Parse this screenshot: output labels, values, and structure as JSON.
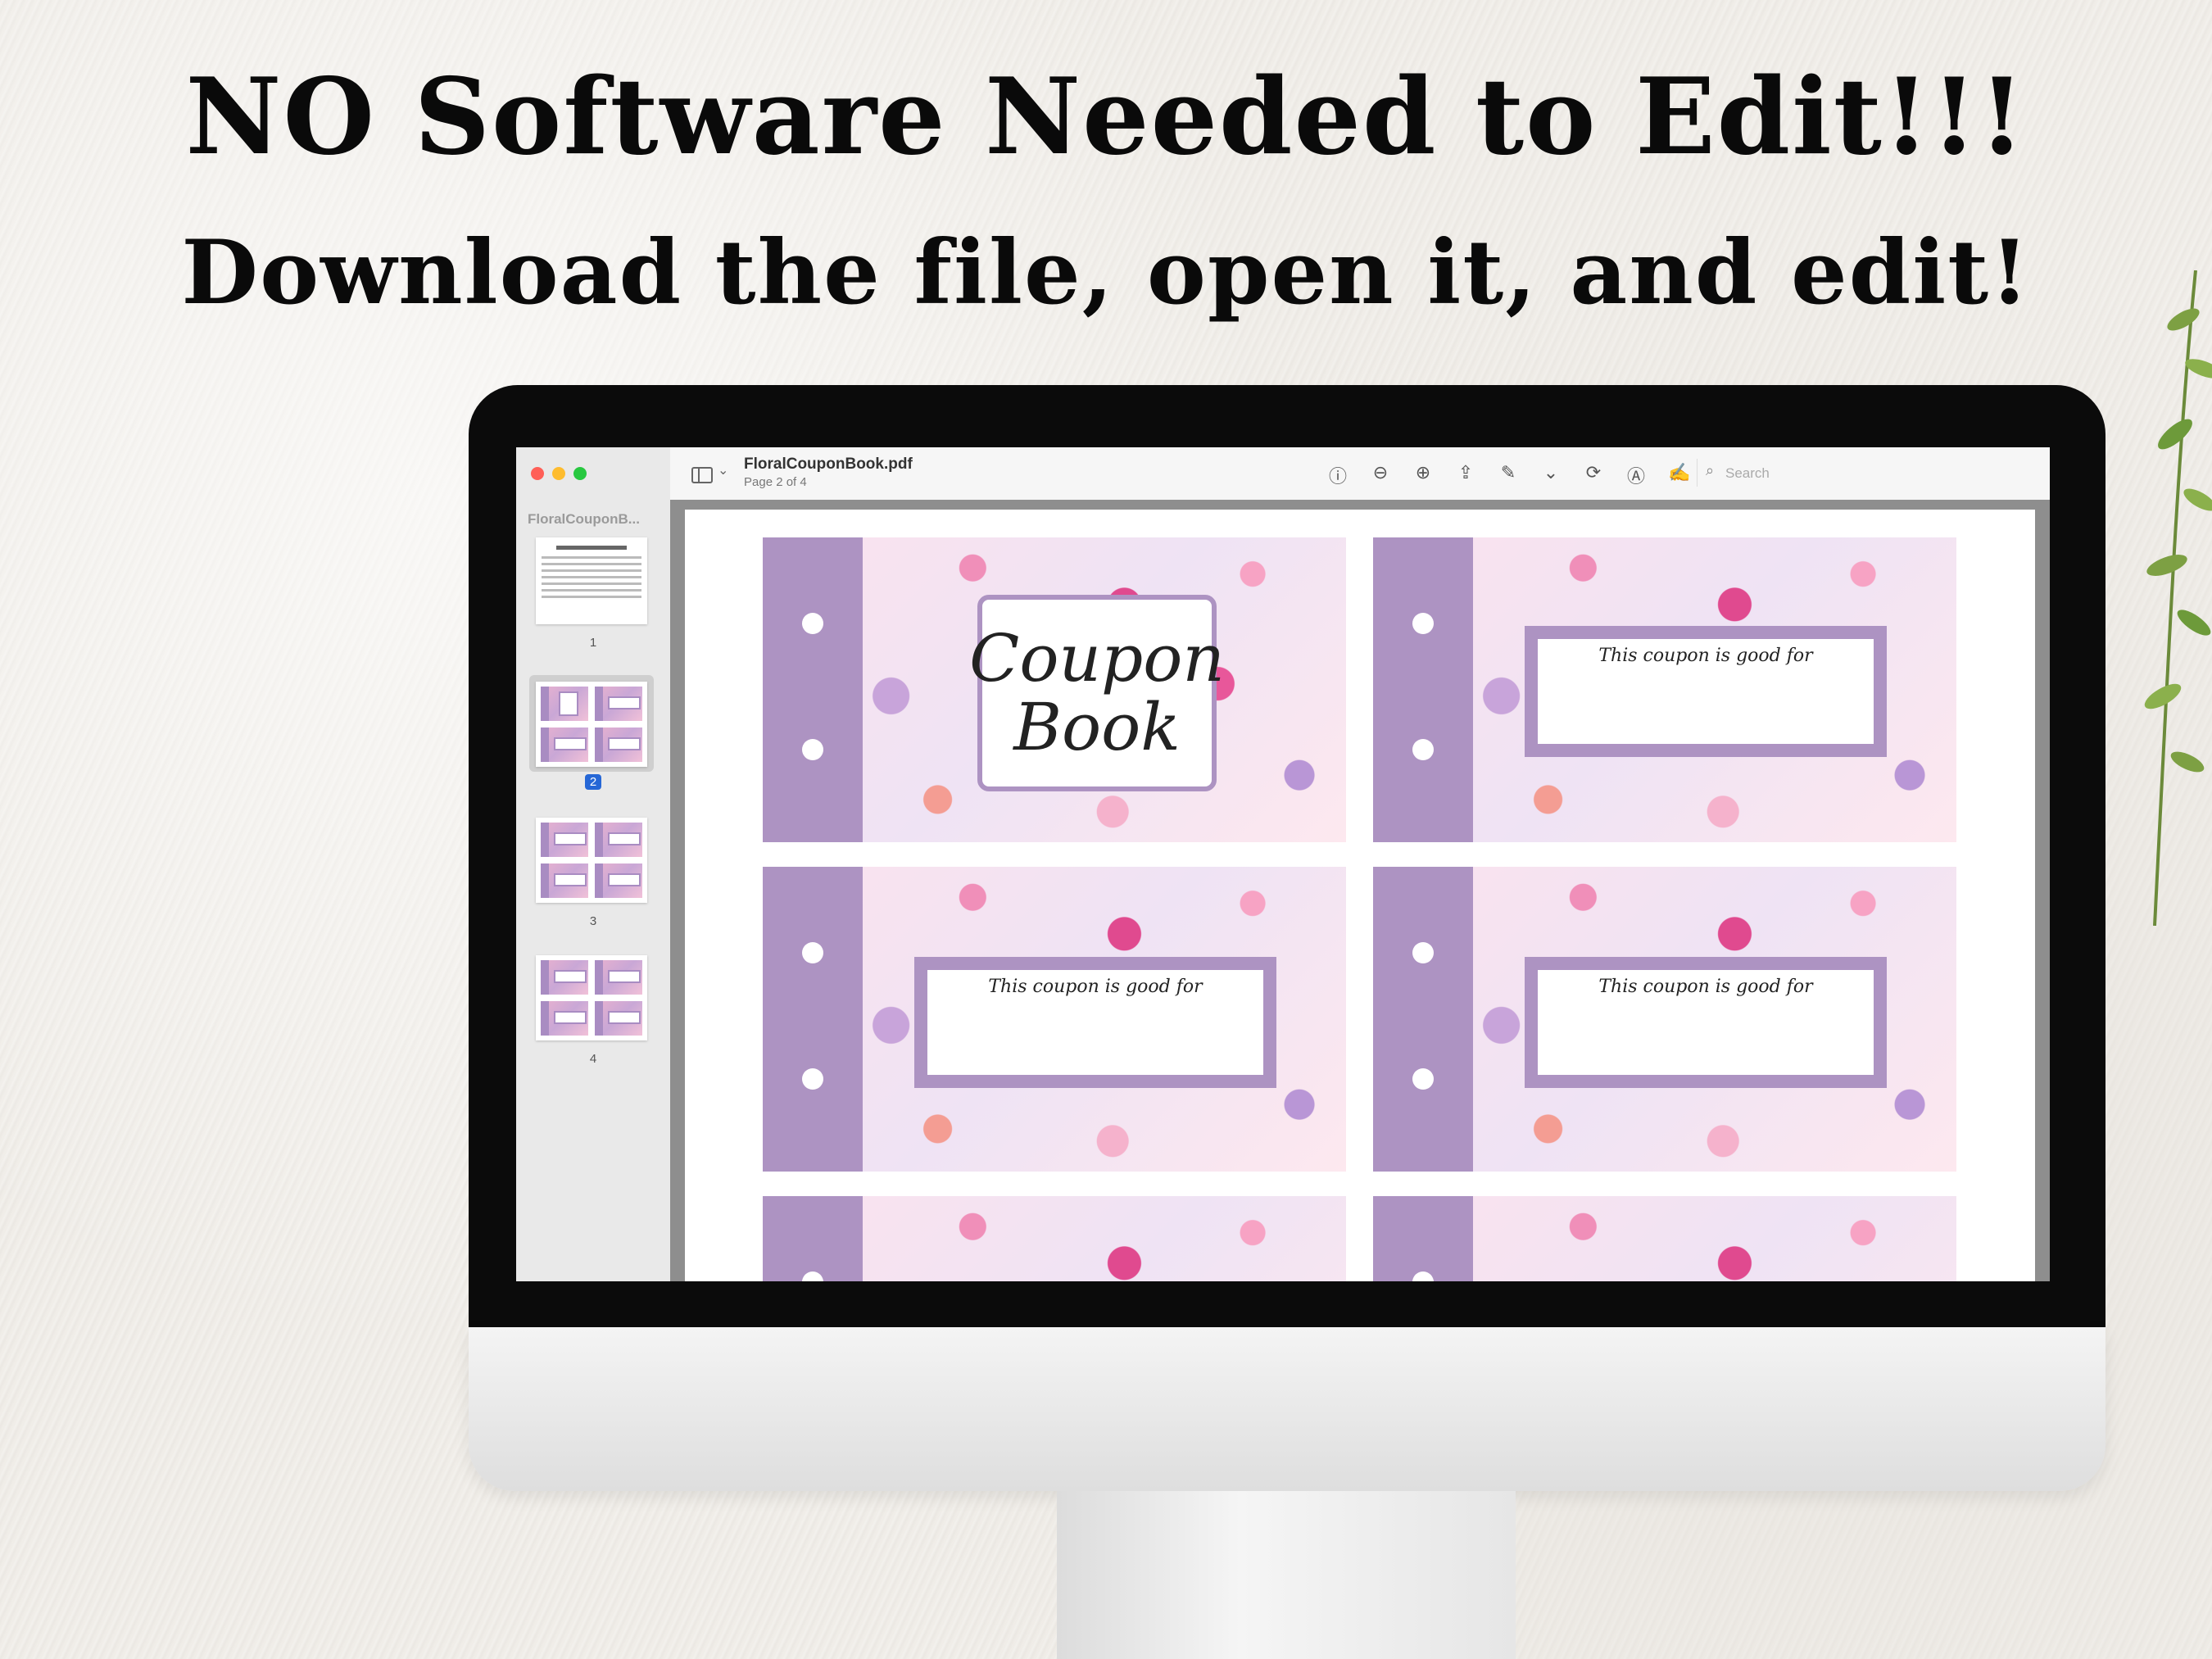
{
  "headline": {
    "line1": "NO Software Needed to Edit!!!",
    "line2": "Download the file, open it, and edit!"
  },
  "viewer": {
    "sidebar_title": "FloralCouponB...",
    "filename": "FloralCouponBook.pdf",
    "page_indicator": "Page 2 of 4",
    "search_placeholder": "Search",
    "thumbnails": [
      {
        "label": "1"
      },
      {
        "label": "2",
        "selected": true
      },
      {
        "label": "3"
      },
      {
        "label": "4"
      }
    ],
    "toolbar_icons": [
      "info-icon",
      "zoom-out-icon",
      "zoom-in-icon",
      "share-icon",
      "markup-pen-icon",
      "chevron-down-icon",
      "rotate-icon",
      "annotate-icon",
      "sign-icon"
    ]
  },
  "document": {
    "cover": {
      "line1": "Coupon",
      "line2": "Book"
    },
    "coupon_text": "This coupon is good for"
  },
  "colors": {
    "strip": "#ad93c2",
    "selected_page_badge": "#2667d6"
  }
}
